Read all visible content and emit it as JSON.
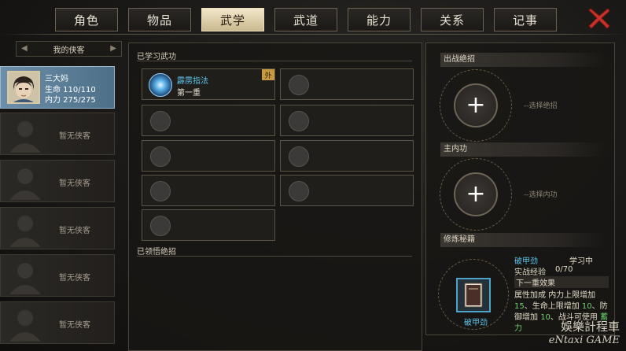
{
  "tabs": [
    {
      "label": "角色",
      "active": false
    },
    {
      "label": "物品",
      "active": false
    },
    {
      "label": "武学",
      "active": true
    },
    {
      "label": "武道",
      "active": false
    },
    {
      "label": "能力",
      "active": false
    },
    {
      "label": "关系",
      "active": false
    },
    {
      "label": "记事",
      "active": false
    }
  ],
  "colors": {
    "accent": "#5cc3ea",
    "tab_active": "#e6d7b0",
    "close": "#c8332b",
    "badge": "#c79a42"
  },
  "left": {
    "header": "我的侠客",
    "selected": {
      "name": "三大妈",
      "hp": "生命 110/110",
      "mp": "内力 275/275"
    },
    "empty_label": "暂无侠客",
    "empty_count": 5
  },
  "middle": {
    "learned_title": "已学习武功",
    "understood_title": "已领悟绝招",
    "skill": {
      "name": "霹雳指法",
      "level": "第一重",
      "badge": "外",
      "icon": "lightning-palm-icon"
    }
  },
  "right": {
    "combat_title": "出战绝招",
    "combat_hint": "--选择绝招",
    "internal_title": "主内功",
    "internal_hint": "--选择内功",
    "cultivate_title": "修炼秘籍",
    "book_name": "破甲劲",
    "book_status": "学习中",
    "exp_label": "实战经验",
    "exp_value": "0/70",
    "next_effect": "下一重效果",
    "attr_label": "属性加成",
    "attr_line1": "内力上限增加",
    "attr_v1": "15",
    "attr_line2": "、生命上限增加",
    "attr_v2": "10",
    "attr_line3": "、防御增加",
    "attr_v3": "10",
    "attr_line4": "、战斗可使用",
    "attr_v4": "蓄力",
    "book_label": "破甲劲"
  },
  "watermark": {
    "line1": "娛樂計程車",
    "line2": "eNtaxi GAME"
  }
}
